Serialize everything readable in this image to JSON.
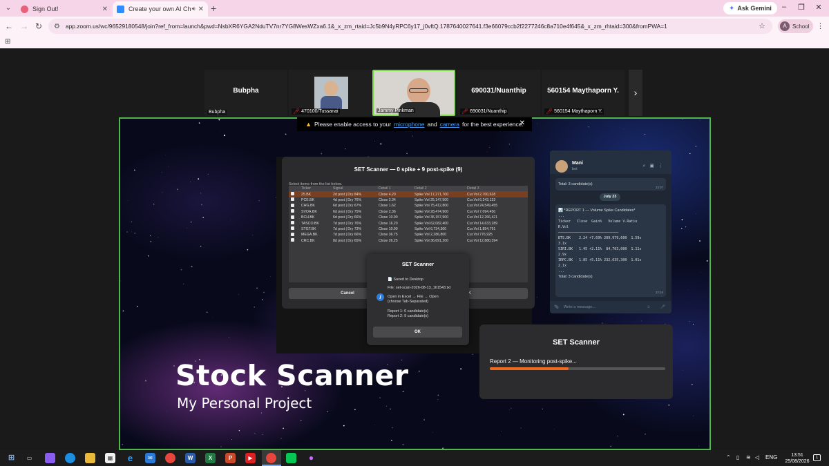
{
  "browser": {
    "tabs": [
      {
        "title": "Sign Out!",
        "favicon_color": "#e9607a"
      },
      {
        "title": "Create your own AI Chatbo",
        "favicon_color": "#2d8cff"
      }
    ],
    "url": "app.zoom.us/wc/96529180548/join?ref_from=launch&pwd=NsbXR6YGA2NduTV7nr7YG8WesWZxa6.1&_x_zm_rtaid=Jc5b9N4yRPC6y17_j0vftQ.1787640027641.f3e66079ccb2f2277246c8a710e4f645&_x_zm_rhtaid=300&fromPWA=1",
    "gemini_label": "Ask Gemini",
    "profile_initial": "A",
    "profile_label": "School"
  },
  "participants": [
    {
      "name": "Bubpha",
      "label": "Bubpha",
      "muted": false
    },
    {
      "name": "",
      "label": "470100/Tussanai",
      "muted": true
    },
    {
      "name": "",
      "label": "Jammy Pinkman",
      "muted": false
    },
    {
      "name": "690031/Nuanthip",
      "label": "690031/Nuanthip",
      "muted": true
    },
    {
      "name": "560154 Maythaporn Y.",
      "label": "560154 Maythaporn Y.",
      "muted": true
    }
  ],
  "permission_bar": {
    "before": "Please enable access to your",
    "mic": "microphone",
    "and": "and",
    "camera": "camera",
    "after": "for the best experience."
  },
  "scanner": {
    "title": "SET Scanner — 0 spike + 9 post-spike (9)",
    "hint": "Select items from the list below.",
    "columns": [
      "Ticker",
      "Signal",
      "Detail 1",
      "Detail 2",
      "Detail 3"
    ],
    "rows": [
      [
        "25.BK",
        "2d post | Dry 84%",
        "Close 4.20",
        "Spike Vol 17,271,700",
        "Cur.Vol 2,700,628"
      ],
      [
        "PCE.BK",
        "4d post | Dry 76%",
        "Close 2.34",
        "Spike Vol 25,147,500",
        "Cur.Vol 6,243,133"
      ],
      [
        "CHG.BK",
        "6d post | Dry 67%",
        "Close 1.62",
        "Spike Vol 75,412,800",
        "Cur.Vol 24,549,455"
      ],
      [
        "SVOA.BK",
        "6d post | Dry 75%",
        "Close 2.36",
        "Spike Vol 28,474,900",
        "Cur.Vol 7,094,450"
      ],
      [
        "BCH.BK",
        "6d post | Dry 66%",
        "Close 10.90",
        "Spike Vol 36,157,900",
        "Cur.Vol 12,266,421"
      ],
      [
        "TASCO.BK",
        "7d post | Dry 76%",
        "Close 16.20",
        "Spike Vol 62,082,400",
        "Cur.Vol 14,633,289"
      ],
      [
        "STGT.BK",
        "7d post | Dry 73%",
        "Close 10.90",
        "Spike Vol 6,734,300",
        "Cur.Vol 1,854,791"
      ],
      [
        "MEGA.BK",
        "7d post | Dry 66%",
        "Close 36.75",
        "Spike Vol 2,286,800",
        "Cur.Vol 776,925"
      ],
      [
        "CRC.BK",
        "8d post | Dry 65%",
        "Close 26.25",
        "Spike Vol 36,691,200",
        "Cur.Vol 12,880,394"
      ]
    ],
    "cancel_label": "Cancel",
    "ok_label": "OK"
  },
  "saved_dialog": {
    "title": "SET Scanner",
    "saved": "Saved to Desktop",
    "file": "File: set-scan-2026-08-13_161543.txt",
    "open1": "Open in Excel → File → Open",
    "open2": "(choose Tab-Separated)",
    "report1": "Report 1: 0 candidate(s)",
    "report2": "Report 2: 9 candidate(s)",
    "ok_label": "OK"
  },
  "chat": {
    "name": "Mani",
    "subtitle": "bot",
    "msg1": "Total: 3 candidate(s)",
    "msg1_time": "23:07",
    "date": "July 23",
    "report_title": "*REPORT 1 — Volume Spike Candidates*",
    "report_body": "...\nTicker   Close  Gain%   Volume V.Ratio\nR.Vol\n─────────────────────────────\nBTS.BK    2.24 +7.69% 209,979,600  1.59x\n3.1x\nSIRI.BK   1.45 +2.11%  84,703,000  1.11x\n2.9x\nIRPC.BK   1.85 +5.11% 232,635,300  1.01x\n2.1x\n...",
    "report_total": "Total: 3 candidate(s)",
    "report_time": "23:16",
    "placeholder": "Write a message..."
  },
  "progress": {
    "title": "SET Scanner",
    "status": "Report 2 — Monitoring post-spike...",
    "fraction": 0.45,
    "color": "#ee6a1f"
  },
  "slide": {
    "headline": "Stock Scanner",
    "subheadline": "My Personal Project"
  },
  "taskbar": {
    "lang": "ENG",
    "time": "13:51",
    "date": "25/08/2026"
  }
}
